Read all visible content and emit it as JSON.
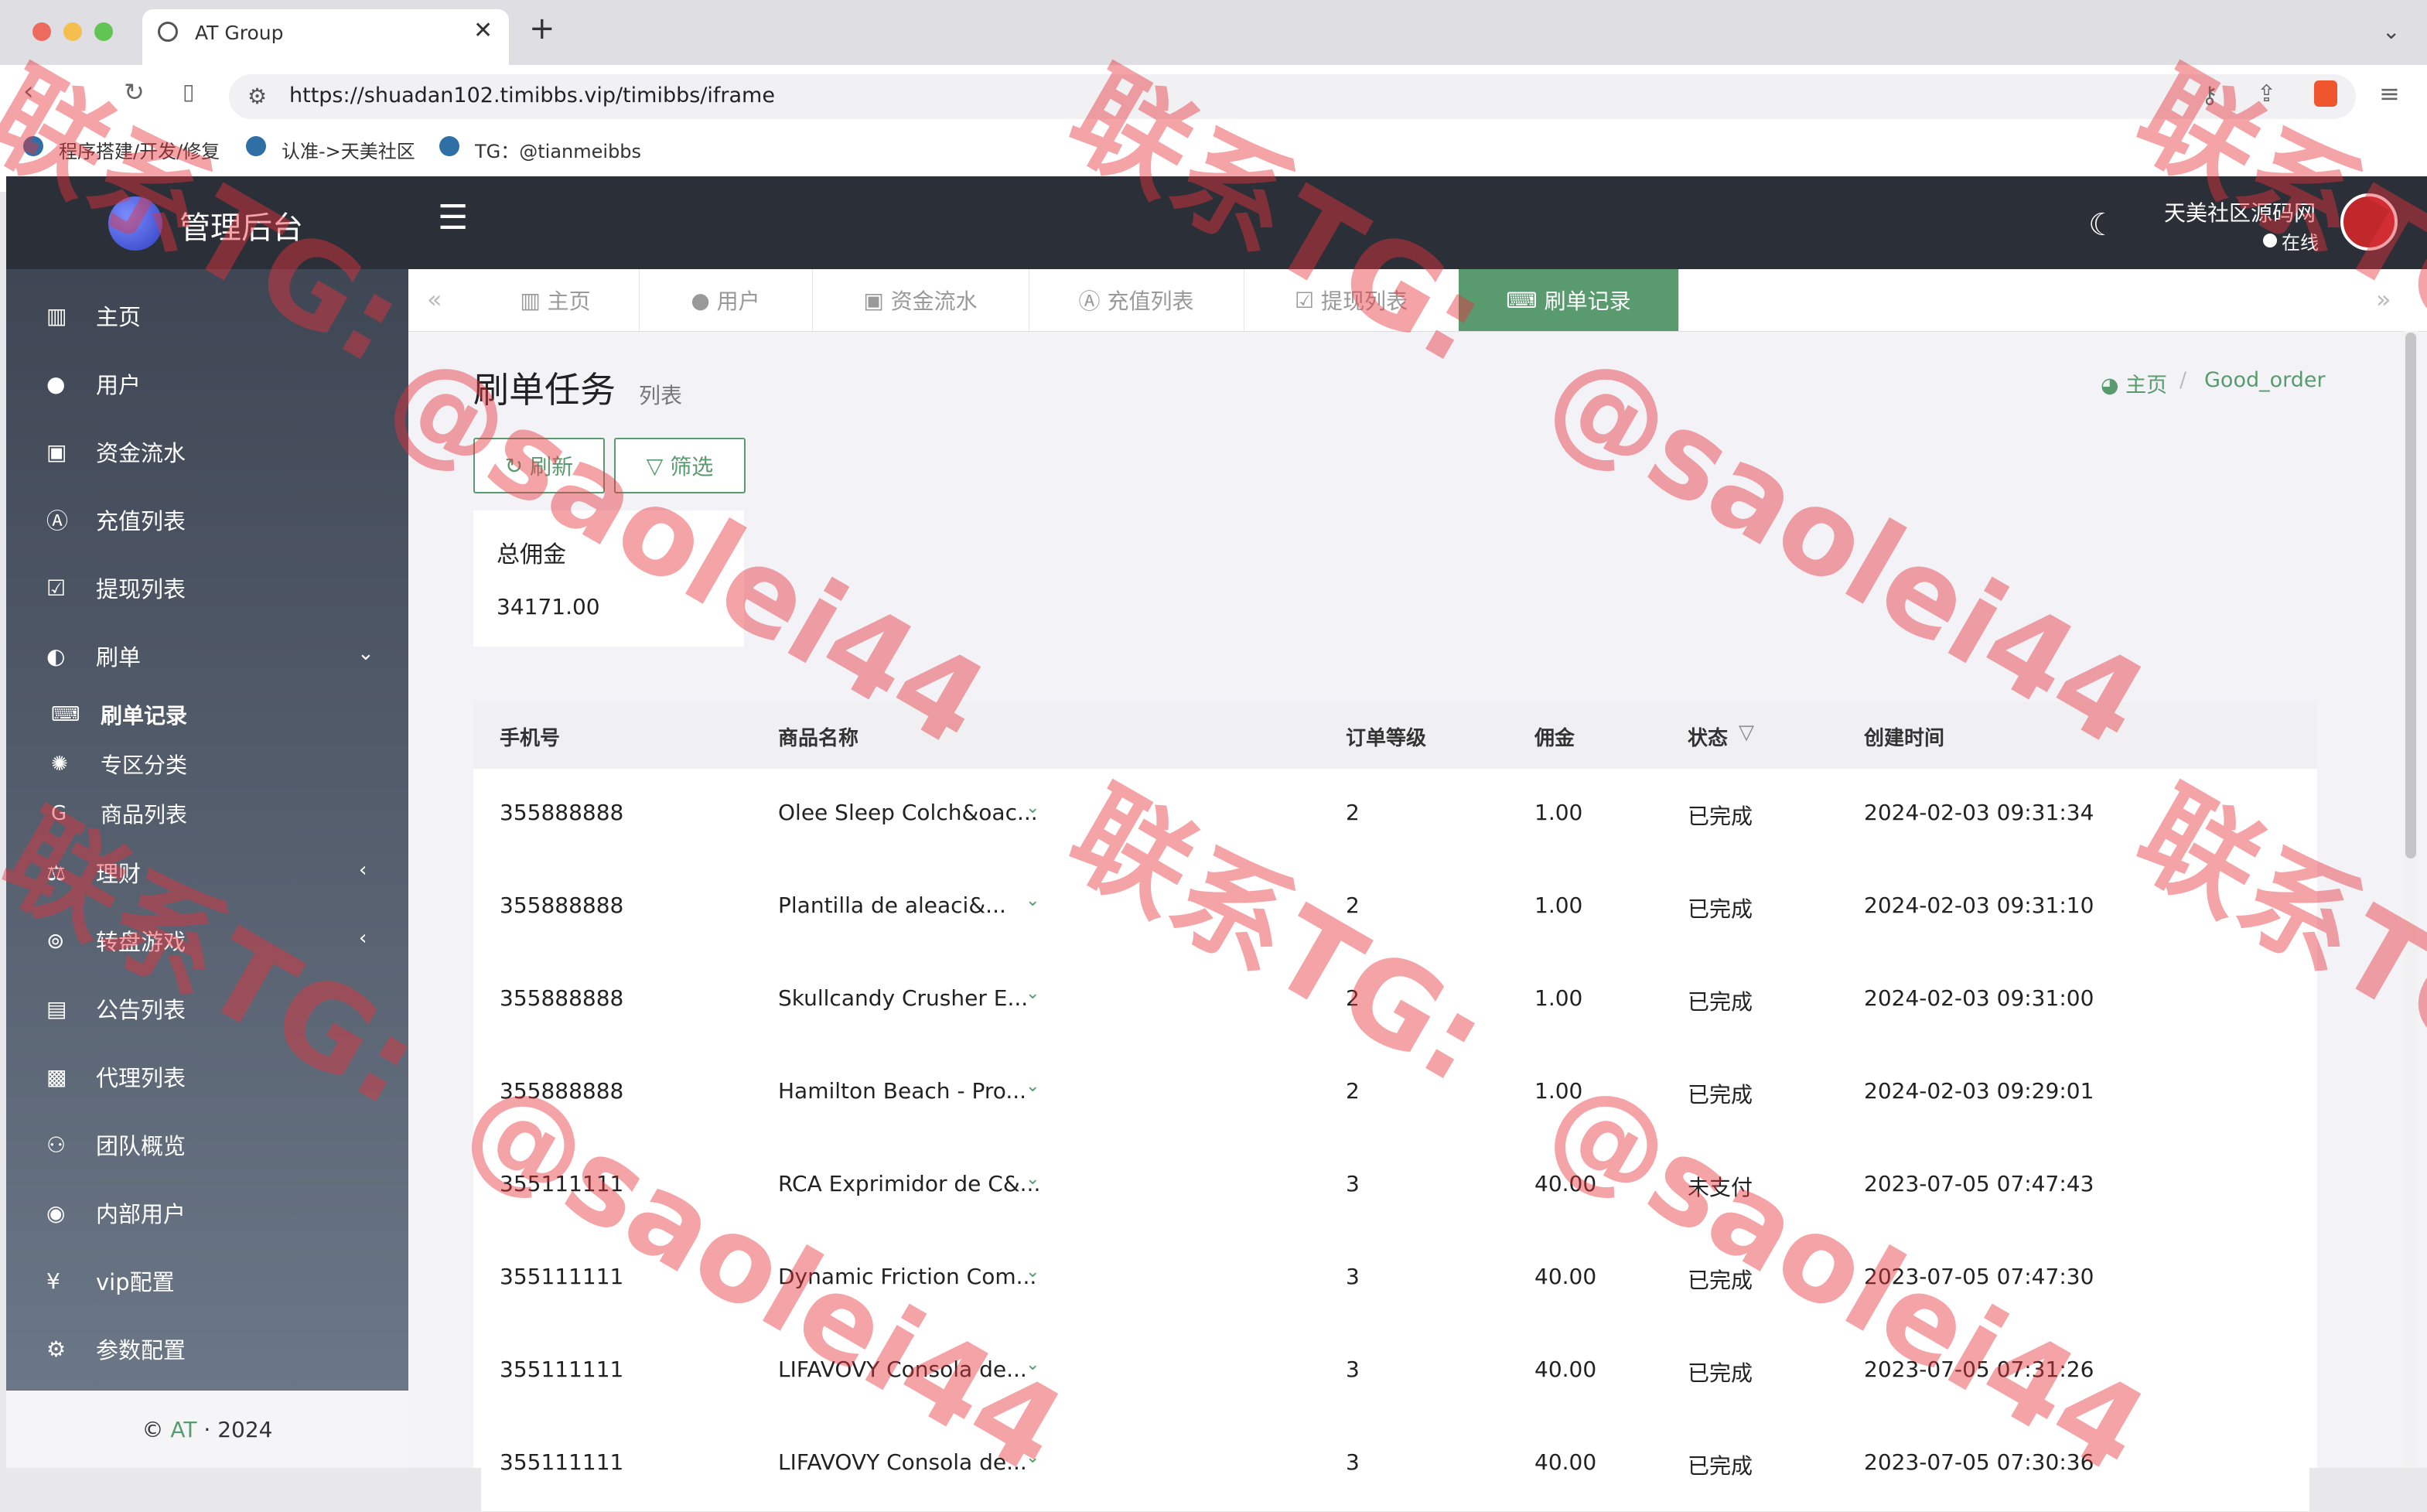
{
  "browser": {
    "tab_title": "AT Group",
    "new_tab": "+",
    "url": "https://shuadan102.timibbs.vip/timibbs/iframe",
    "bookmarks": [
      "程序搭建/开发/修复",
      "认准->天美社区",
      "TG：@tianmeibbs"
    ]
  },
  "app": {
    "logo_title": "管理后台",
    "site_name": "天美社区源码网",
    "online_status": "在线"
  },
  "sidebar": {
    "items": [
      {
        "label": "主页",
        "icon": "bar-chart-icon"
      },
      {
        "label": "用户",
        "icon": "user-icon"
      },
      {
        "label": "资金流水",
        "icon": "money-icon"
      },
      {
        "label": "充值列表",
        "icon": "a-box-icon"
      },
      {
        "label": "提现列表",
        "icon": "checkbox-icon"
      },
      {
        "label": "刷单",
        "icon": "half-circle-icon"
      }
    ],
    "sub_items": [
      {
        "label": "刷单记录",
        "icon": "keyboard-icon"
      },
      {
        "label": "专区分类",
        "icon": "gear-icon"
      },
      {
        "label": "商品列表",
        "icon": "g-icon"
      }
    ],
    "more_items": [
      {
        "label": "理财",
        "icon": "chart-icon"
      },
      {
        "label": "转盘游戏",
        "icon": "gamepad-icon"
      },
      {
        "label": "公告列表",
        "icon": "document-icon"
      },
      {
        "label": "代理列表",
        "icon": "contact-icon"
      },
      {
        "label": "团队概览",
        "icon": "users-icon"
      },
      {
        "label": "内部用户",
        "icon": "user-circle-icon"
      },
      {
        "label": "vip配置",
        "icon": "yen-icon"
      },
      {
        "label": "参数配置",
        "icon": "gears-icon"
      }
    ],
    "footer_copy": "©",
    "footer_brand": "AT",
    "footer_sep": "·",
    "footer_year": "2024"
  },
  "page_tabs": [
    {
      "label": "主页"
    },
    {
      "label": "用户"
    },
    {
      "label": "资金流水"
    },
    {
      "label": "充值列表"
    },
    {
      "label": "提现列表"
    },
    {
      "label": "刷单记录"
    }
  ],
  "page": {
    "title": "刷单任务",
    "subtitle": "列表",
    "breadcrumb_home": "主页",
    "breadcrumb_sep": "/",
    "breadcrumb_current": "Good_order",
    "refresh_label": "刷新",
    "filter_label": "筛选",
    "card_title": "总佣金",
    "card_value": "34171.00"
  },
  "table": {
    "columns": [
      "手机号",
      "商品名称",
      "订单等级",
      "佣金",
      "状态",
      "创建时间"
    ],
    "rows": [
      [
        "355888888",
        "Olee Sleep Colch&oac...",
        "2",
        "1.00",
        "已完成",
        "2024-02-03 09:31:34"
      ],
      [
        "355888888",
        "Plantilla de aleaci&...",
        "2",
        "1.00",
        "已完成",
        "2024-02-03 09:31:10"
      ],
      [
        "355888888",
        "Skullcandy Crusher E...",
        "2",
        "1.00",
        "已完成",
        "2024-02-03 09:31:00"
      ],
      [
        "355888888",
        "Hamilton Beach - Pro...",
        "2",
        "1.00",
        "已完成",
        "2024-02-03 09:29:01"
      ],
      [
        "355111111",
        "RCA Exprimidor de C&...",
        "3",
        "40.00",
        "未支付",
        "2023-07-05 07:47:43"
      ],
      [
        "355111111",
        "Dynamic Friction Com...",
        "3",
        "40.00",
        "已完成",
        "2023-07-05 07:47:30"
      ],
      [
        "355111111",
        "LIFAVOVY Consola de...",
        "3",
        "40.00",
        "已完成",
        "2023-07-05 07:31:26"
      ],
      [
        "355111111",
        "LIFAVOVY Consola de...",
        "3",
        "40.00",
        "已完成",
        "2023-07-05 07:30:36"
      ]
    ]
  },
  "watermark": {
    "line1": "联系TG:",
    "line2": "@saolei44"
  },
  "colors": {
    "accent": "#5a9a6f",
    "sidebar_top": "#3b4250",
    "topbar": "#2a2f38",
    "watermark": "#e6323c"
  }
}
